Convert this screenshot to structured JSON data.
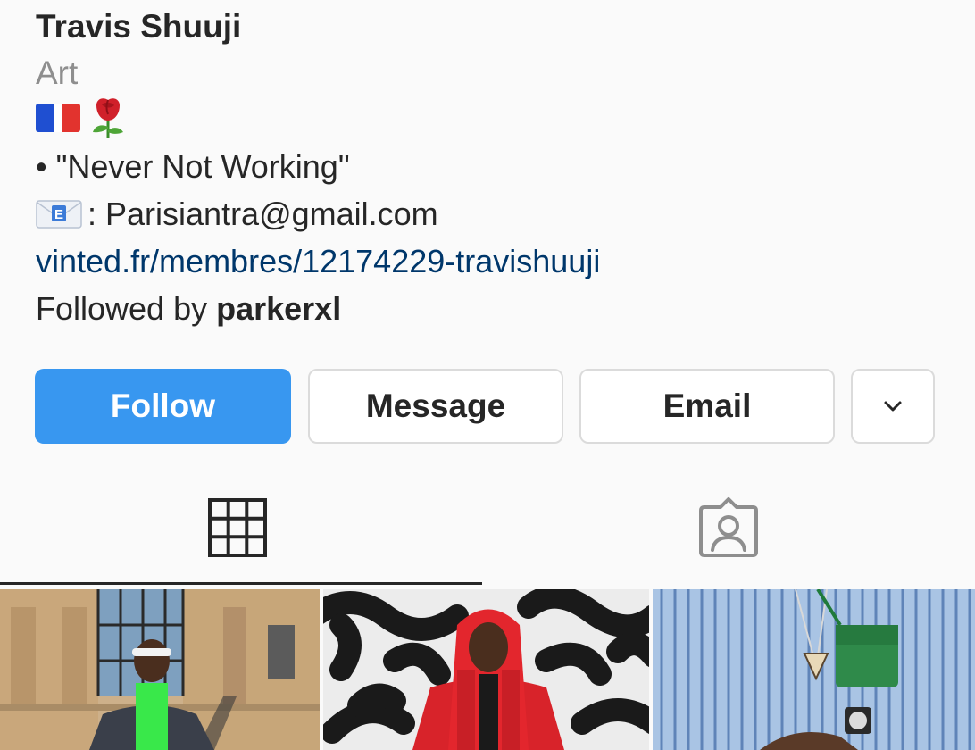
{
  "profile": {
    "name": "Travis Shuuji",
    "category": "Art",
    "quote": "• \"Never Not Working\"",
    "email_line": ": Parisiantra@gmail.com",
    "link": "vinted.fr/membres/12174229-travishuuji",
    "followed_prefix": "Followed by ",
    "followed_user": "parkerxl"
  },
  "icons": {
    "flag": "france-flag-icon",
    "rose": "rose-icon",
    "envelope": "email-envelope-icon",
    "chevron": "chevron-down-icon",
    "grid_tab": "grid-icon",
    "tagged_tab": "tagged-person-icon"
  },
  "buttons": {
    "follow": "Follow",
    "message": "Message",
    "email": "Email"
  },
  "colors": {
    "accent": "#3897f0",
    "link": "#00376b",
    "secondary_text": "#8e8e8e"
  }
}
